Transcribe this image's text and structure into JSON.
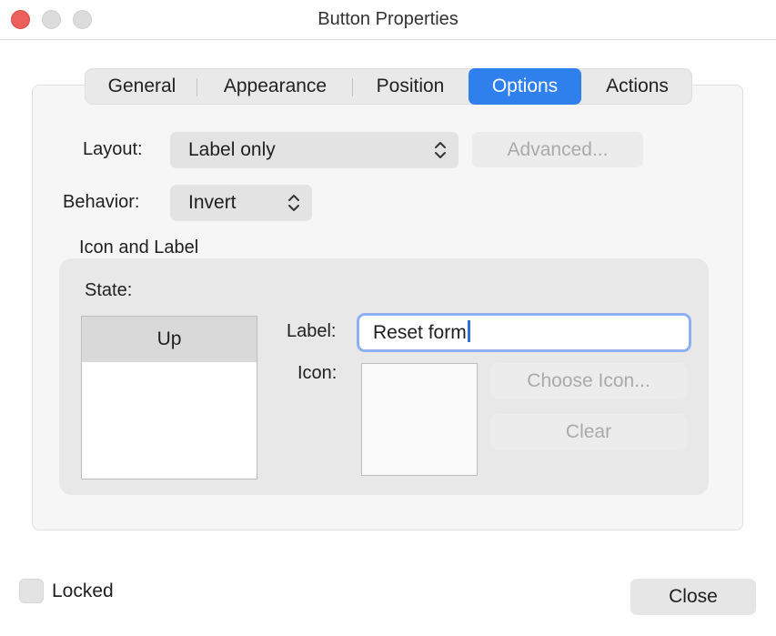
{
  "window": {
    "title": "Button Properties"
  },
  "tabs": [
    {
      "label": "General"
    },
    {
      "label": "Appearance"
    },
    {
      "label": "Position"
    },
    {
      "label": "Options",
      "active": true
    },
    {
      "label": "Actions"
    }
  ],
  "options": {
    "layout_label": "Layout:",
    "layout_value": "Label only",
    "advanced_button": "Advanced...",
    "behavior_label": "Behavior:",
    "behavior_value": "Invert",
    "group_title": "Icon and Label",
    "state_label": "State:",
    "states": [
      "Up"
    ],
    "label_label": "Label:",
    "label_value": "Reset form",
    "icon_label": "Icon:",
    "choose_icon_button": "Choose Icon...",
    "clear_button": "Clear"
  },
  "footer": {
    "locked_label": "Locked",
    "locked_checked": false,
    "close_button": "Close"
  },
  "colors": {
    "accent": "#2f80ed",
    "close_traffic_light": "#ec5f5a",
    "focus_ring": "#8fb0f0"
  }
}
